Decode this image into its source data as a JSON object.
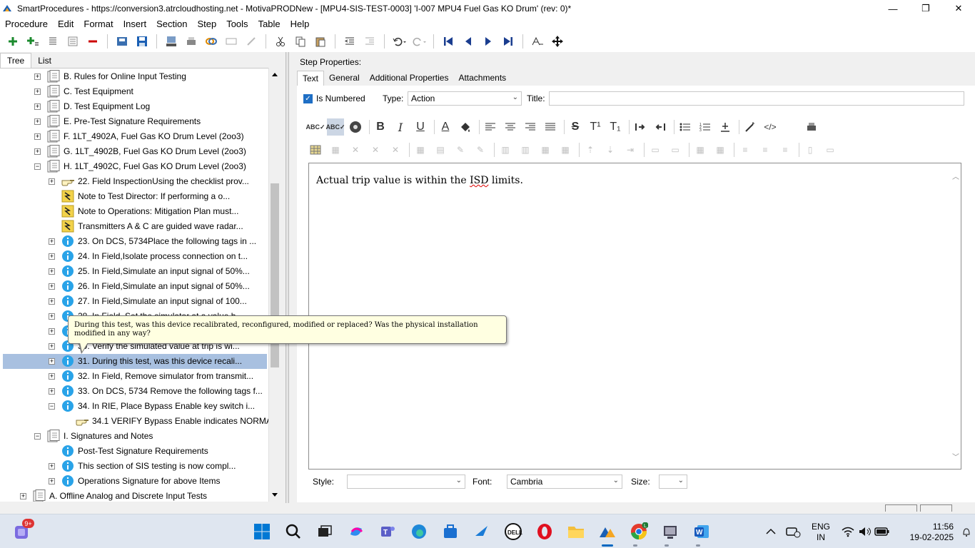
{
  "window": {
    "title": "SmartProcedures - https://conversion3.atrcloudhosting.net - MotivaPRODNew - [MPU4-SIS-TEST-0003] 'I-007 MPU4 Fuel Gas KO Drum' (rev: 0)*",
    "minimize": "—",
    "maximize": "❐",
    "close": "✕"
  },
  "menu": [
    "Procedure",
    "Edit",
    "Format",
    "Insert",
    "Section",
    "Step",
    "Tools",
    "Table",
    "Help"
  ],
  "left_tabs": [
    "Tree",
    "List"
  ],
  "tree": [
    {
      "label": "B. Rules for Online Input Testing",
      "indent": 0,
      "icon": "section-icon",
      "exp": "+"
    },
    {
      "label": "C. Test Equipment",
      "indent": 0,
      "icon": "section-icon",
      "exp": "+"
    },
    {
      "label": "D. Test Equipment Log",
      "indent": 0,
      "icon": "section-icon",
      "exp": "+"
    },
    {
      "label": "E. Pre-Test Signature Requirements",
      "indent": 0,
      "icon": "section-icon",
      "exp": "+"
    },
    {
      "label": "F. 1LT_4902A, Fuel Gas KO Drum Level (2oo3)",
      "indent": 0,
      "icon": "section-icon",
      "exp": "+"
    },
    {
      "label": "G. 1LT_4902B, Fuel Gas KO Drum Level (2oo3)",
      "indent": 0,
      "icon": "section-icon",
      "exp": "+"
    },
    {
      "label": "H. 1LT_4902C, Fuel Gas KO Drum Level (2oo3)",
      "indent": 0,
      "icon": "section-icon",
      "exp": "-"
    },
    {
      "label": "22. Field InspectionUsing the checklist prov...",
      "indent": 1,
      "icon": "hand-icon",
      "exp": "+"
    },
    {
      "label": "Note to Test Director: If performing a o...",
      "indent": 1,
      "icon": "note-icon",
      "exp": ""
    },
    {
      "label": "Note to Operations: Mitigation Plan must...",
      "indent": 1,
      "icon": "note-icon",
      "exp": ""
    },
    {
      "label": "Transmitters A & C are guided wave radar...",
      "indent": 1,
      "icon": "note-icon",
      "exp": ""
    },
    {
      "label": "23. On DCS, 5734Place the following tags in ...",
      "indent": 1,
      "icon": "info-icon",
      "exp": "+"
    },
    {
      "label": "24. In Field,Isolate process connection on t...",
      "indent": 1,
      "icon": "info-icon",
      "exp": "+"
    },
    {
      "label": "25. In Field,Simulate an input signal of 50%...",
      "indent": 1,
      "icon": "info-icon",
      "exp": "+"
    },
    {
      "label": "26. In Field,Simulate an input signal of 50%...",
      "indent": 1,
      "icon": "info-icon",
      "exp": "+"
    },
    {
      "label": "27. In Field,Simulate an input signal of 100...",
      "indent": 1,
      "icon": "info-icon",
      "exp": "+"
    },
    {
      "label": "28. In Field, Set the simulator at a value b...",
      "indent": 1,
      "icon": "info-icon",
      "exp": "+"
    },
    {
      "label": "",
      "indent": 1,
      "icon": "info-icon",
      "exp": "+"
    },
    {
      "label": "30. Verify the simulated value at trip is wi...",
      "indent": 1,
      "icon": "info-icon",
      "exp": "+"
    },
    {
      "label": "31. During this test, was this device recali...",
      "indent": 1,
      "icon": "info-icon",
      "exp": "+",
      "selected": true
    },
    {
      "label": "32. In Field, Remove simulator from transmit...",
      "indent": 1,
      "icon": "info-icon",
      "exp": "+"
    },
    {
      "label": "33. On DCS, 5734 Remove the following tags f...",
      "indent": 1,
      "icon": "info-icon",
      "exp": "+"
    },
    {
      "label": "34. In RIE, Place Bypass Enable key switch i...",
      "indent": 1,
      "icon": "info-icon",
      "exp": "-"
    },
    {
      "label": "34.1 VERIFY Bypass Enable indicates NORMAL",
      "indent": 2,
      "icon": "hand-icon",
      "exp": ""
    },
    {
      "label": "I. Signatures and Notes",
      "indent": 0,
      "icon": "section-icon",
      "exp": "-"
    },
    {
      "label": "Post-Test Signature Requirements",
      "indent": 1,
      "icon": "info-icon",
      "exp": ""
    },
    {
      "label": "This section of SIS testing is now compl...",
      "indent": 1,
      "icon": "info-icon",
      "exp": "+"
    },
    {
      "label": "Operations Signature for above Items",
      "indent": 1,
      "icon": "info-icon",
      "exp": "+"
    },
    {
      "label": "A. Offline Analog and Discrete Input Tests",
      "indent": -1,
      "icon": "section-icon",
      "exp": "+"
    }
  ],
  "tooltip": "During this test, was this device recalibrated, reconfigured, modified or replaced? Was the physical installation modified in any way?",
  "step_props": {
    "label": "Step Properties:",
    "tabs": [
      "Text",
      "General",
      "Additional Properties",
      "Attachments"
    ],
    "is_numbered_label": "Is Numbered",
    "is_numbered": true,
    "type_label": "Type:",
    "type_value": "Action",
    "title_label": "Title:",
    "title_value": ""
  },
  "editor": {
    "text_before": "Actual trip value is within the ",
    "text_misspelled": "ISD",
    "text_after": " limits."
  },
  "bottom": {
    "style_label": "Style:",
    "style_value": "",
    "font_label": "Font:",
    "font_value": "Cambria",
    "size_label": "Size:",
    "size_value": ""
  },
  "taskbar": {
    "badge": "9+",
    "chrome_badge": "L",
    "lang_line1": "ENG",
    "lang_line2": "IN",
    "time": "11:56",
    "date": "19-02-2025"
  },
  "colors": {
    "selection": "#a8c0e0",
    "info_icon": "#29a3e8",
    "accent": "#1f6fc5"
  }
}
